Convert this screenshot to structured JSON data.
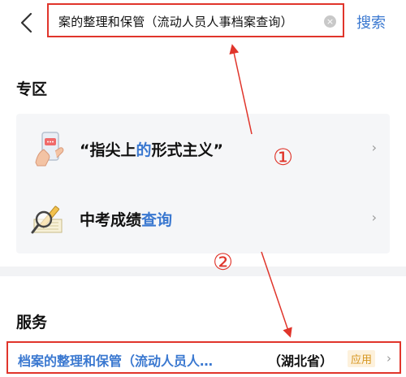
{
  "search": {
    "query": "案的整理和保管（流动人员人事档案查询）",
    "clear_icon": "×",
    "button": "搜索"
  },
  "zone": {
    "title": "专区",
    "items": [
      {
        "pre": "“指尖上",
        "hl": "的",
        "post": "形式主义”",
        "chev": "›",
        "icon": "phone-hand-icon"
      },
      {
        "pre": "中考成绩",
        "hl": "查询",
        "post": "",
        "chev": "›",
        "icon": "magnifier-pencil-icon"
      }
    ]
  },
  "service": {
    "title": "服务",
    "row": {
      "name": "档案的整理和保管（流动人员人…",
      "region": "（湖北省）",
      "badge": "应用",
      "chev": "›"
    }
  },
  "annotations": {
    "marker_1": "①",
    "marker_2": "②",
    "color": "#e0352b"
  },
  "colors": {
    "accent": "#3a78d0",
    "highlight_border": "#e0352b",
    "badge_bg": "#fdf1dc",
    "badge_text": "#d6951e"
  }
}
